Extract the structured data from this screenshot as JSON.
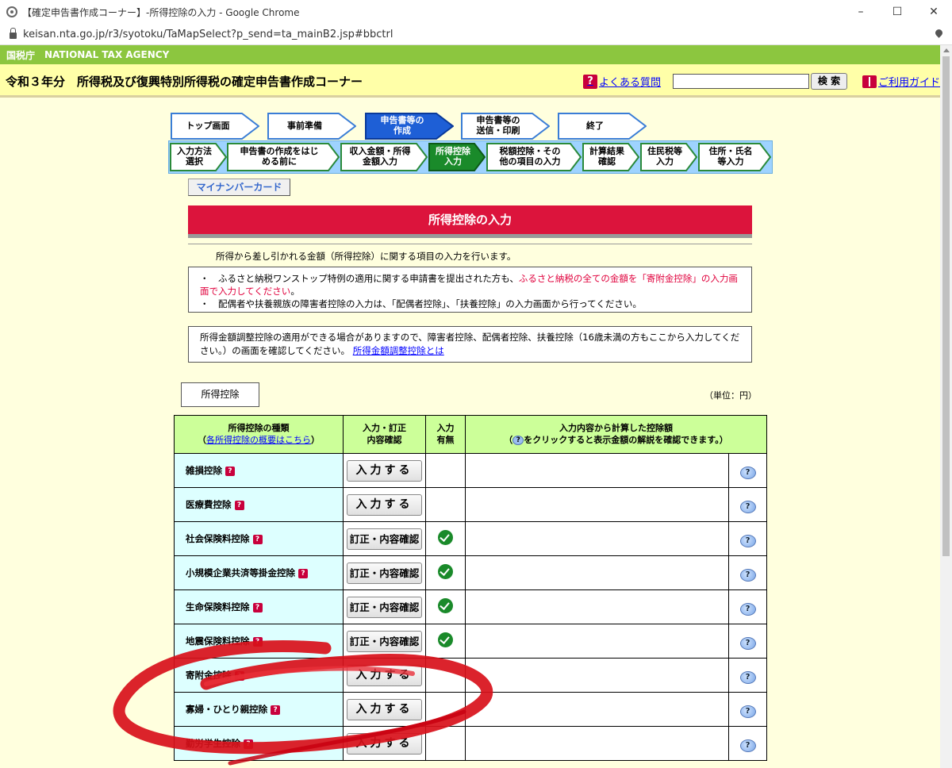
{
  "window": {
    "title": "【確定申告書作成コーナー】-所得控除の入力 - Google Chrome",
    "url": "keisan.nta.go.jp/r3/syotoku/TaMapSelect?p_send=ta_mainB2.jsp#bbctrl",
    "controls": [
      "–",
      "☐",
      "✕"
    ]
  },
  "header": {
    "agency_jp": "国税庁",
    "agency_en": "NATIONAL TAX AGENCY",
    "corner_title": "令和３年分　所得税及び復興特別所得税の確定申告書作成コーナー",
    "faq_label": "よくある質問",
    "faq_icon": "?",
    "search_placeholder": "",
    "search_button": "検 索",
    "guide_label": "ご利用ガイド"
  },
  "steps_main": [
    {
      "label": "トップ画面",
      "active": false
    },
    {
      "label": "事前準備",
      "active": false
    },
    {
      "label": "申告書等の\n作成",
      "active": true
    },
    {
      "label": "申告書等の\n送信・印刷",
      "active": false
    },
    {
      "label": "終了",
      "active": false
    }
  ],
  "steps_sub": [
    {
      "label": "入力方法\n選択",
      "active": false
    },
    {
      "label": "申告書の作成をはじ\nめる前に",
      "active": false
    },
    {
      "label": "収入金額・所得\n金額入力",
      "active": false
    },
    {
      "label": "所得控除\n入力",
      "active": true
    },
    {
      "label": "税額控除・その\n他の項目の入力",
      "active": false
    },
    {
      "label": "計算結果\n確認",
      "active": false
    },
    {
      "label": "住民税等\n入力",
      "active": false
    },
    {
      "label": "住所・氏名\n等入力",
      "active": false
    }
  ],
  "mynumber_button": "マイナンバーカード",
  "page_title": "所得控除の入力",
  "intro": "所得から差し引かれる金額（所得控除）に関する項目の入力を行います。",
  "notes": {
    "bullet": "・",
    "line1_black": "ふるさと納税ワンストップ特例の適用に関する申請書を提出された方も、",
    "line1_red": "ふるさと納税の全ての金額を「寄附金控除」の入力画面で入力してください",
    "line1_end": "。",
    "line2": "配偶者や扶養親族の障害者控除の入力は、「配偶者控除」、「扶養控除」の入力画面から行ってください。"
  },
  "adjustment_note": {
    "text": "所得金額調整控除の適用ができる場合がありますので、障害者控除、配偶者控除、扶養控除（16歳未満の方もここから入力してください。）の画面を確認してください。",
    "link": "所得金額調整控除とは"
  },
  "section_tab": "所得控除",
  "unit": "（単位：円）",
  "table": {
    "headers": {
      "type": "所得控除の種類",
      "type_link": "各所得控除の概要はこちら",
      "confirm": "入力・訂正\n内容確認",
      "has_input": "入力\n有無",
      "amount_line1": "入力内容から計算した控除額",
      "amount_line2_pre": "（",
      "amount_line2_post": "をクリックすると表示金額の解説を確認できます。）"
    },
    "rows": [
      {
        "name": "雑損控除",
        "button": "入力する",
        "checked": false
      },
      {
        "name": "医療費控除",
        "button": "入力する",
        "checked": false
      },
      {
        "name": "社会保険料控除",
        "button": "訂正・内容確認",
        "checked": true
      },
      {
        "name": "小規模企業共済等掛金控除",
        "button": "訂正・内容確認",
        "checked": true
      },
      {
        "name": "生命保険料控除",
        "button": "訂正・内容確認",
        "checked": true
      },
      {
        "name": "地震保険料控除",
        "button": "訂正・内容確認",
        "checked": true
      },
      {
        "name": "寄附金控除",
        "button": "入力する",
        "checked": false
      },
      {
        "name": "寡婦・ひとり親控除",
        "button": "入力する",
        "checked": false
      },
      {
        "name": "勤労学生控除",
        "button": "入力する",
        "checked": false
      }
    ],
    "help_icon": "?"
  }
}
